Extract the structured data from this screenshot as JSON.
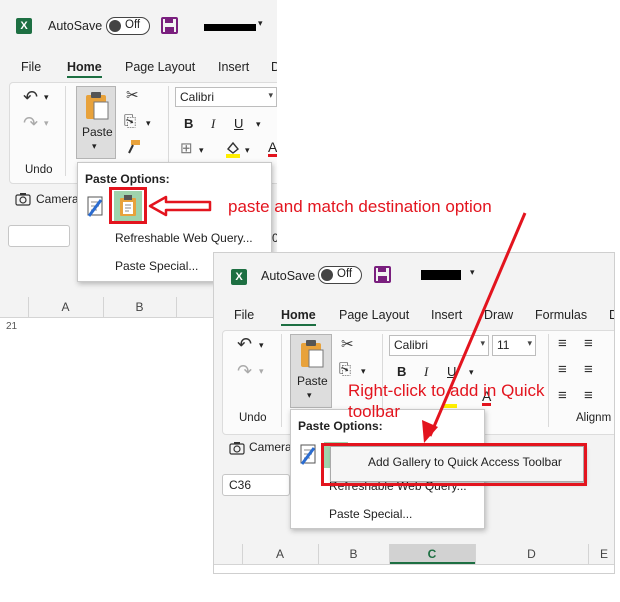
{
  "window1": {
    "autosave_label": "AutoSave",
    "autosave_state": "Off",
    "tabs": [
      "File",
      "Home",
      "Page Layout",
      "Insert",
      "D"
    ],
    "undo_label": "Undo",
    "paste_label": "Paste",
    "font_name": "Calibri",
    "camera_label": "Camera",
    "clipped_text": "0",
    "columns": [
      "A",
      "B"
    ],
    "row_number": "21",
    "paste_menu": {
      "title": "Paste Options:",
      "items": [
        "Refreshable Web Query...",
        "Paste Special..."
      ]
    }
  },
  "window2": {
    "autosave_label": "AutoSave",
    "autosave_state": "Off",
    "tabs": [
      "File",
      "Home",
      "Page Layout",
      "Insert",
      "Draw",
      "Formulas",
      "D"
    ],
    "undo_label": "Undo",
    "paste_label": "Paste",
    "font_name": "Calibri",
    "font_size": "11",
    "camera_label": "Camera",
    "alignment_label": "Alignm",
    "name_box": "C36",
    "columns": [
      "A",
      "B",
      "C",
      "D",
      "E"
    ],
    "paste_menu": {
      "title": "Paste Options:",
      "items": [
        "Refreshable Web Query...",
        "Paste Special..."
      ]
    },
    "context_menu_item": "Add Gallery to Quick Access Toolbar"
  },
  "annotations": {
    "paste_match": "paste and match destination option",
    "right_click": "Right-click to add in Quick toolbar"
  },
  "colors": {
    "annotation_red": "#e3141e",
    "excel_green": "#1d6f42",
    "save_purple": "#7a1f7e"
  },
  "icons": [
    "excel-icon",
    "save-icon",
    "undo-icon",
    "redo-icon",
    "paste-icon",
    "cut-icon",
    "copy-icon",
    "format-painter-icon",
    "camera-icon",
    "bold-icon",
    "italic-icon",
    "underline-icon",
    "borders-icon",
    "fill-color-icon",
    "font-color-icon",
    "align-icon"
  ]
}
